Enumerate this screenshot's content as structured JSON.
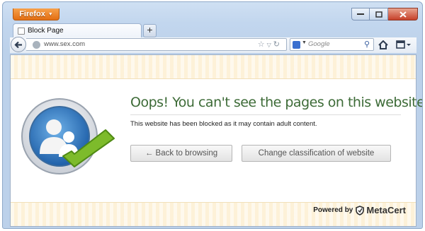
{
  "browser": {
    "menu_button_label": "Firefox",
    "tab_title": "Block Page",
    "new_tab_label": "+",
    "url": "www.sex.com",
    "search_placeholder": "Google"
  },
  "page": {
    "heading": "Oops! You can't see the pages on this website",
    "message": "This website has been blocked as it may contain adult content.",
    "back_button": "← Back to browsing",
    "change_button": "Change classification of website",
    "powered_by": "Powered by",
    "brand": "MetaCert"
  },
  "colors": {
    "heading": "#3d6b37",
    "stripe": "#fdf1d8",
    "firefox_button": "#e36e12",
    "check": "#7dbb2b"
  },
  "icons": {
    "back": "back-arrow-icon",
    "bookmark": "star-icon",
    "reload": "reload-icon",
    "home": "home-icon",
    "search": "magnifier-icon",
    "logo": "users-check-icon",
    "brand": "shield-icon"
  }
}
